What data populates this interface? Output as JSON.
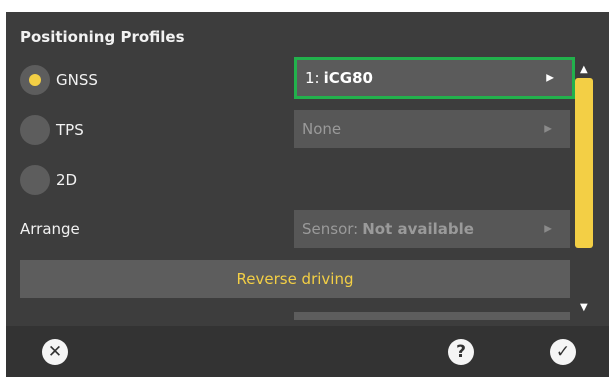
{
  "title": "Positioning Profiles",
  "radios": {
    "gnss": {
      "label": "GNSS",
      "selected": true
    },
    "tps": {
      "label": "TPS",
      "selected": false
    },
    "twod": {
      "label": "2D",
      "selected": false
    }
  },
  "selects": {
    "gnss_number": "1:",
    "gnss_value": "iCG80",
    "tps_value": "None",
    "sensor_label": "Sensor:",
    "sensor_value": "Not available"
  },
  "arrange_label": "Arrange",
  "reverse_driving_label": "Reverse driving",
  "icons": {
    "close": "close-circle-icon",
    "help": "help-circle-icon",
    "confirm": "check-circle-icon",
    "dropdown": "triangle-right-icon"
  },
  "colors": {
    "accent_yellow": "#f3cf45",
    "focus_green": "#22b14c",
    "panel_bg": "#3d3d3d"
  }
}
